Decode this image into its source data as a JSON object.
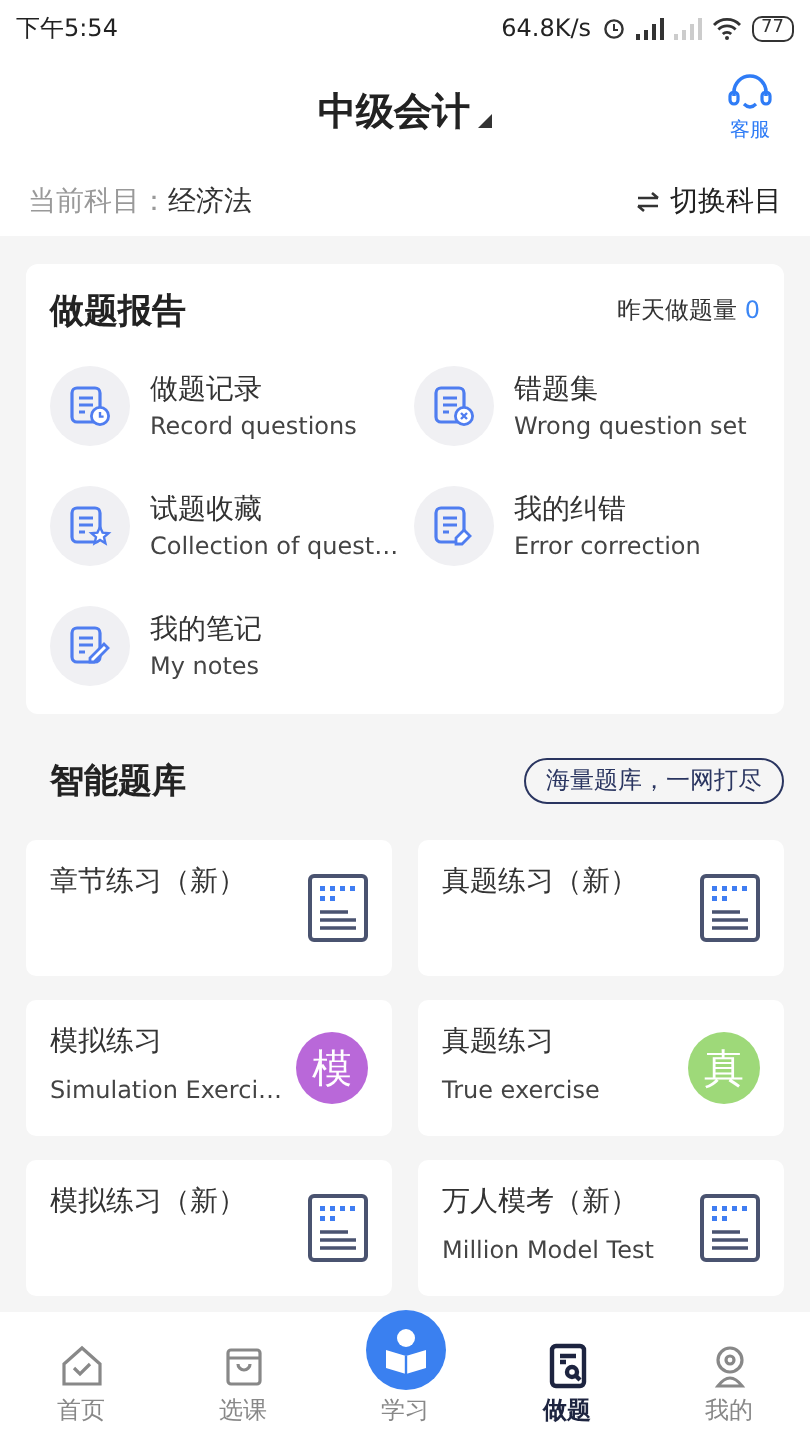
{
  "status_bar": {
    "time": "下午5:54",
    "speed": "64.8K/s",
    "battery": "77"
  },
  "header": {
    "title": "中级会计",
    "service_label": "客服"
  },
  "subject": {
    "label": "当前科目：",
    "value": "经济法",
    "switch_label": "切换科目"
  },
  "report": {
    "title": "做题报告",
    "yesterday_label": "昨天做题量",
    "yesterday_count": "0",
    "items": [
      {
        "title": "做题记录",
        "subtitle": "Record questions"
      },
      {
        "title": "错题集",
        "subtitle": "Wrong question set"
      },
      {
        "title": "试题收藏",
        "subtitle": "Collection of quest…"
      },
      {
        "title": "我的纠错",
        "subtitle": "Error correction"
      },
      {
        "title": "我的笔记",
        "subtitle": "My notes"
      }
    ]
  },
  "bank": {
    "title": "智能题库",
    "tag": "海量题库，一网打尽",
    "tiles": [
      {
        "kind": "doc",
        "title": "章节练习（新）"
      },
      {
        "kind": "doc",
        "title": "真题练习（新）"
      },
      {
        "kind": "badge",
        "title": "模拟练习",
        "subtitle": "Simulation Exerci…",
        "badge": "模",
        "color": "#b968d9"
      },
      {
        "kind": "badge",
        "title": "真题练习",
        "subtitle": "True exercise",
        "badge": "真",
        "color": "#9ed979"
      },
      {
        "kind": "doc",
        "title": "模拟练习（新）"
      },
      {
        "kind": "doc",
        "title": "万人模考（新）",
        "subtitle": "Million Model Test"
      }
    ]
  },
  "tab_bar": [
    {
      "label": "首页",
      "kind": "normal",
      "selected": false
    },
    {
      "label": "选课",
      "kind": "normal",
      "selected": false
    },
    {
      "label": "学习",
      "kind": "center",
      "selected": false
    },
    {
      "label": "做题",
      "kind": "normal",
      "selected": true
    },
    {
      "label": "我的",
      "kind": "normal",
      "selected": false
    }
  ]
}
